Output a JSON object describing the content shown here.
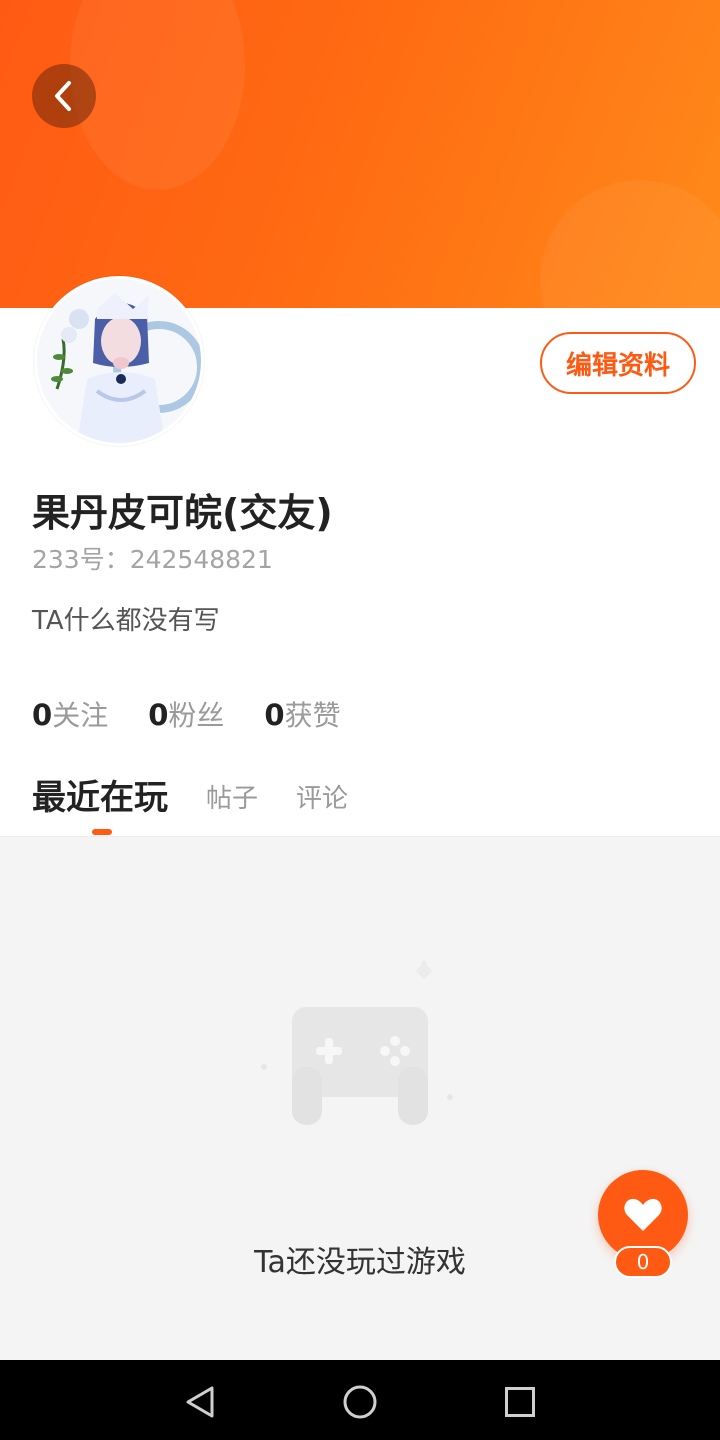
{
  "header": {
    "back_icon": "chevron-left-icon"
  },
  "profile": {
    "edit_label": "编辑资料",
    "nickname": "果丹皮可皖(交友)",
    "uid_label": "233号：",
    "uid_value": "242548821",
    "bio": "TA什么都没有写",
    "stats": [
      {
        "num": "0",
        "label": "关注"
      },
      {
        "num": "0",
        "label": "粉丝"
      },
      {
        "num": "0",
        "label": "获赞"
      }
    ]
  },
  "tabs": [
    {
      "label": "最近在玩",
      "active": true
    },
    {
      "label": "帖子",
      "active": false
    },
    {
      "label": "评论",
      "active": false
    }
  ],
  "empty_state": {
    "text": "Ta还没玩过游戏",
    "icon": "gamepad-icon"
  },
  "like": {
    "icon": "heart-icon",
    "count": "0"
  },
  "colors": {
    "accent": "#ff5a14",
    "banner_start": "#ff5a14",
    "banner_end": "#ff8a1a"
  }
}
